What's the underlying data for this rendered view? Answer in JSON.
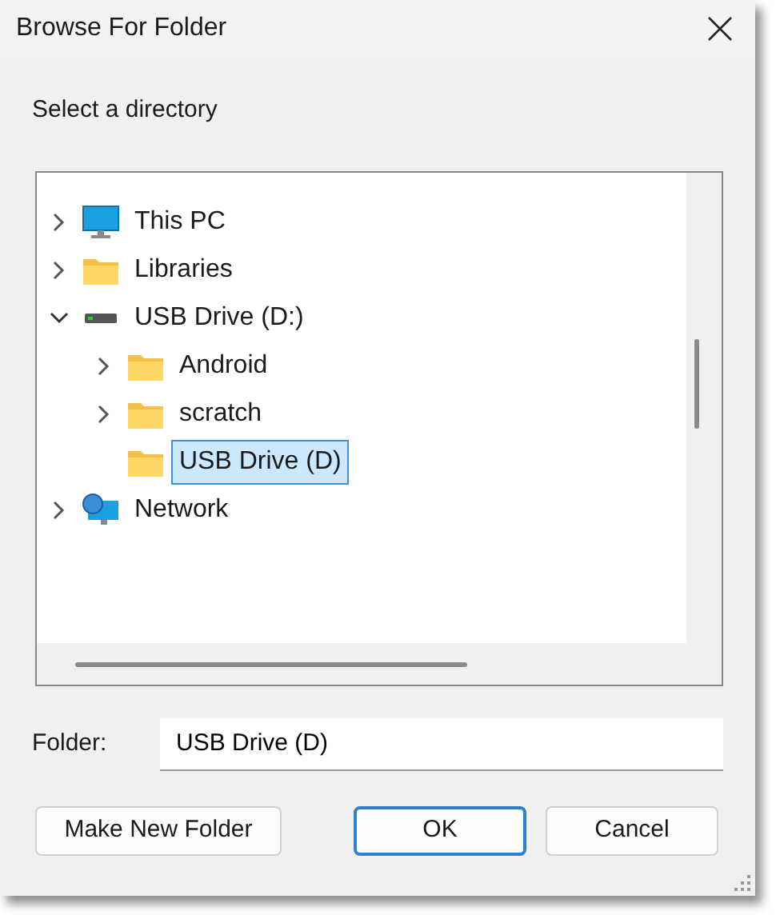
{
  "window": {
    "title": "Browse For Folder"
  },
  "prompt": "Select a directory",
  "tree": [
    {
      "label": "This PC",
      "kind": "computer",
      "expanded": false,
      "selected": false
    },
    {
      "label": "Libraries",
      "kind": "folder",
      "expanded": false,
      "selected": false
    },
    {
      "label": "USB Drive (D:)",
      "kind": "drive",
      "expanded": true,
      "selected": false,
      "children": [
        {
          "label": "Android",
          "kind": "folder",
          "expanded": false,
          "selected": false
        },
        {
          "label": "scratch",
          "kind": "folder",
          "expanded": false,
          "selected": false
        },
        {
          "label": "USB Drive (D)",
          "kind": "folder",
          "selected": true
        }
      ]
    },
    {
      "label": "Network",
      "kind": "network",
      "expanded": false,
      "selected": false
    }
  ],
  "folder_field": {
    "label": "Folder:",
    "value": "USB Drive (D)"
  },
  "buttons": [
    {
      "label": "Make New Folder",
      "default": false
    },
    {
      "label": "OK",
      "default": true
    },
    {
      "label": "Cancel",
      "default": false
    }
  ]
}
